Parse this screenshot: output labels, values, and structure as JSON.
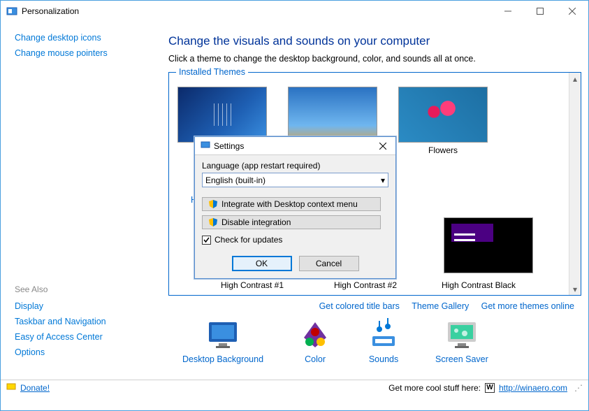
{
  "window": {
    "title": "Personalization"
  },
  "sidebar": {
    "links": [
      "Change desktop icons",
      "Change mouse pointers"
    ],
    "see_also_label": "See Also",
    "see_also": [
      "Display",
      "Taskbar and Navigation",
      "Easy of Access Center",
      "Options"
    ]
  },
  "main": {
    "heading": "Change the visuals and sounds on your computer",
    "subtitle": "Click a theme to change the desktop background, color, and sounds all at once.",
    "group_installed": "Installed Themes",
    "themes_row1": [
      {
        "name": ""
      },
      {
        "name": ""
      },
      {
        "name": "Flowers"
      }
    ],
    "group_hc_partial": "H",
    "themes_row2": [
      {
        "name": "High Contrast #1"
      },
      {
        "name": "High Contrast #2"
      },
      {
        "name": "High Contrast Black"
      }
    ]
  },
  "links_row": [
    "Get colored title bars",
    "Theme Gallery",
    "Get more themes online"
  ],
  "bottom": [
    {
      "label": "Desktop Background"
    },
    {
      "label": "Color"
    },
    {
      "label": "Sounds"
    },
    {
      "label": "Screen Saver"
    }
  ],
  "status": {
    "donate": "Donate!",
    "stuff": "Get more cool stuff here:",
    "link": "http://winaero.com"
  },
  "dialog": {
    "title": "Settings",
    "language_label": "Language (app restart required)",
    "language_value": "English (built-in)",
    "btn_integrate": "Integrate with Desktop context menu",
    "btn_disable": "Disable integration",
    "check_updates": "Check for updates",
    "check_updates_checked": true,
    "ok": "OK",
    "cancel": "Cancel"
  }
}
